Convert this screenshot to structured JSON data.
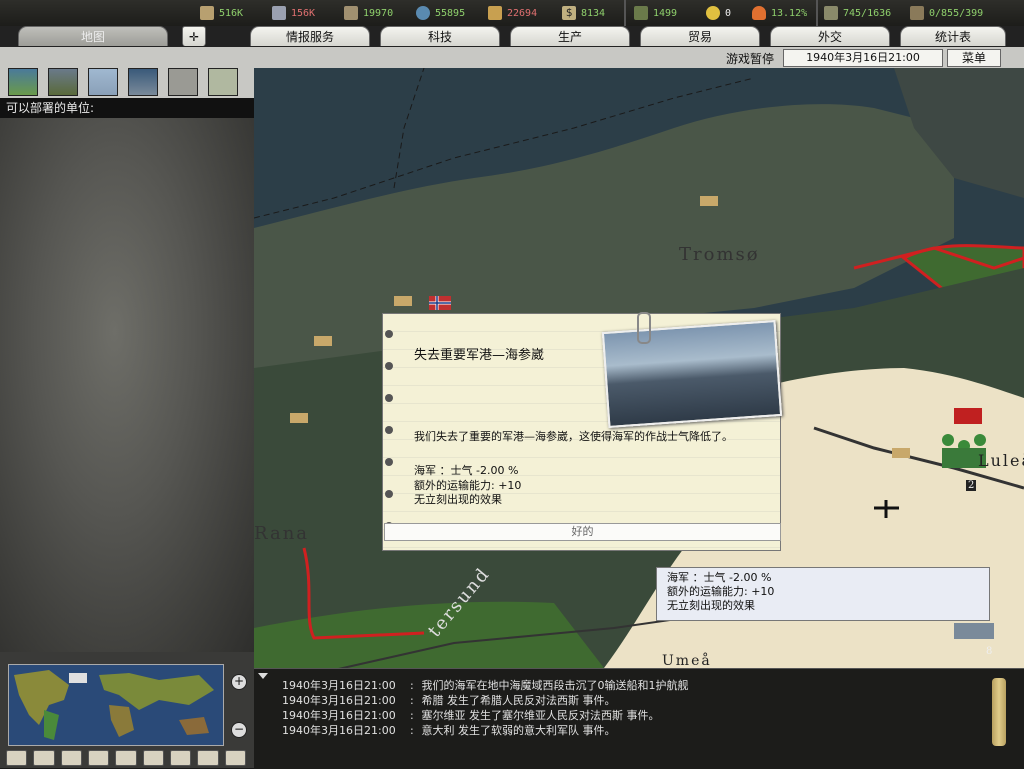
{
  "resources": [
    {
      "icon": "energy-icon",
      "value": "516K",
      "color": "green"
    },
    {
      "icon": "metal-icon",
      "value": "156K",
      "color": "red"
    },
    {
      "icon": "rare-materials-icon",
      "value": "19970",
      "color": "green"
    },
    {
      "icon": "oil-icon",
      "value": "55895",
      "color": "green"
    },
    {
      "icon": "supplies-icon",
      "value": "22694",
      "color": "red"
    },
    {
      "icon": "money-icon",
      "value": "8134",
      "color": "green"
    },
    {
      "icon": "manpower-icon",
      "value": "1499",
      "color": "green"
    },
    {
      "icon": "nuclear-icon",
      "value": "0",
      "color": "white"
    },
    {
      "icon": "dissent-icon",
      "value": "13.12%",
      "color": "green"
    },
    {
      "icon": "transport-icon",
      "value": "745/1636",
      "color": "green"
    },
    {
      "icon": "escort-icon",
      "value": "0/855/399",
      "color": "green"
    }
  ],
  "tabs": [
    "地图",
    "情报服务",
    "科技",
    "生产",
    "贸易",
    "外交",
    "统计表"
  ],
  "status": {
    "paused": "游戏暂停",
    "date": "1940年3月16日21:00",
    "menu": "菜单"
  },
  "left_panel": {
    "deploy_label": "可以部署的单位:"
  },
  "map_labels": {
    "tromso": "Tromsø",
    "rana": "Rana",
    "umea": "Umeå",
    "ostersund": "tersund",
    "lulea": "Luleå",
    "unit_count_2": "2",
    "unit_count_8": "8"
  },
  "dialog": {
    "title": "失去重要军港—海参崴",
    "description": "我们失去了重要的军港—海参崴，这使得海军的作战士气降低了。",
    "effect_line1": "海军 ：士气    -2.00 %",
    "effect_line2": "额外的运输能力: +10",
    "effect_line3": "无立刻出现的效果",
    "ok_label": "好的"
  },
  "tooltip": {
    "line1": "海军 ：士气    -2.00 %",
    "line2": "额外的运输能力: +10",
    "line3": "无立刻出现的效果"
  },
  "log": [
    {
      "time": "1940年3月16日21:00",
      "text": "我们的海军在地中海魔域西段击沉了0输送船和1护航舰"
    },
    {
      "time": "1940年3月16日21:00",
      "text": "希腊 发生了希腊人民反对法西斯 事件。"
    },
    {
      "time": "1940年3月16日21:00",
      "text": "塞尔维亚 发生了塞尔维亚人民反对法西斯 事件。"
    },
    {
      "time": "1940年3月16日21:00",
      "text": "意大利 发生了软弱的意大利军队 事件。"
    }
  ],
  "colors": {
    "border_red": "#d02020",
    "sea": "#2c3e48",
    "land_dark": "#4a5648",
    "land_light": "#ece2c6"
  }
}
